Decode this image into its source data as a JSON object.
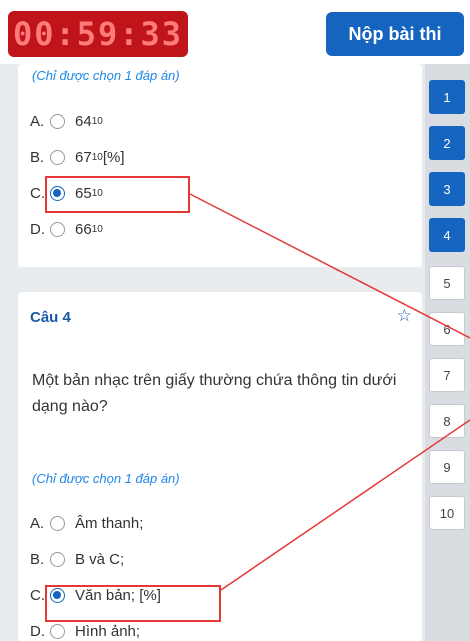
{
  "header": {
    "timer": "00:59:33",
    "submit_label": "Nộp bài thi"
  },
  "question3": {
    "hint": "(Chỉ được chọn 1 đáp án)",
    "options": [
      {
        "letter": "A.",
        "value": "64",
        "sub": "10",
        "suffix": "",
        "checked": false
      },
      {
        "letter": "B.",
        "value": "67",
        "sub": "10",
        "suffix": "[%]",
        "checked": false
      },
      {
        "letter": "C.",
        "value": "65",
        "sub": "10",
        "suffix": "",
        "checked": true
      },
      {
        "letter": "D.",
        "value": "66",
        "sub": "10",
        "suffix": "",
        "checked": false
      }
    ]
  },
  "question4": {
    "title": "Câu 4",
    "text": "Một bản nhạc trên giấy thường chứa thông tin dưới dạng nào?",
    "hint": "(Chỉ được chọn 1 đáp án)",
    "options": [
      {
        "letter": "A.",
        "label": "Âm thanh;",
        "checked": false
      },
      {
        "letter": "B.",
        "label": "B và C;",
        "checked": false
      },
      {
        "letter": "C.",
        "label": "Văn bản; [%]",
        "checked": true
      },
      {
        "letter": "D.",
        "label": "Hình ảnh;",
        "checked": false
      }
    ]
  },
  "navigator": {
    "items": [
      {
        "label": "1",
        "answered": true
      },
      {
        "label": "2",
        "answered": true
      },
      {
        "label": "3",
        "answered": true
      },
      {
        "label": "4",
        "answered": true
      },
      {
        "label": "5",
        "answered": false
      },
      {
        "label": "6",
        "answered": false
      },
      {
        "label": "7",
        "answered": false
      },
      {
        "label": "8",
        "answered": false
      },
      {
        "label": "9",
        "answered": false
      },
      {
        "label": "10",
        "answered": false
      }
    ]
  },
  "colors": {
    "timer_bg": "#c0141b",
    "accent": "#1565c0",
    "highlight": "#e53935"
  }
}
